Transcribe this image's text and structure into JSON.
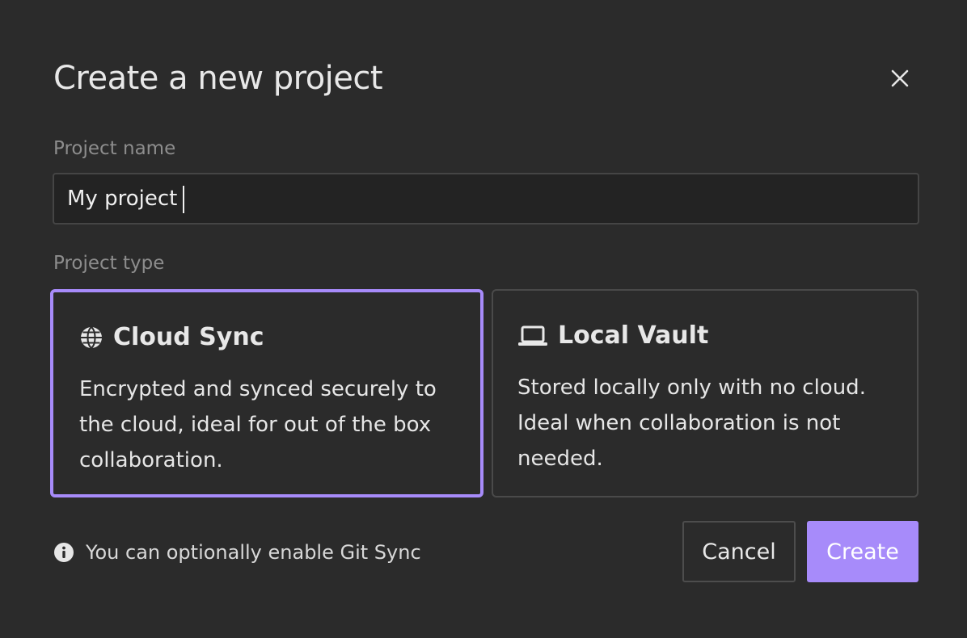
{
  "dialog": {
    "title": "Create a new project",
    "close_icon": "close-icon"
  },
  "name_field": {
    "label": "Project name",
    "value": "My project"
  },
  "type_field": {
    "label": "Project type",
    "selected": "cloud_sync",
    "options": [
      {
        "id": "cloud_sync",
        "title": "Cloud Sync",
        "icon": "globe-icon",
        "description": "Encrypted and synced securely to the cloud, ideal for out of the box collaboration."
      },
      {
        "id": "local_vault",
        "title": "Local Vault",
        "icon": "laptop-icon",
        "description": "Stored locally only with no cloud. Ideal when collaboration is not needed."
      }
    ]
  },
  "hint": {
    "icon": "info-icon",
    "text": "You can optionally enable Git Sync"
  },
  "actions": {
    "cancel_label": "Cancel",
    "create_label": "Create"
  },
  "colors": {
    "background": "#2b2b2b",
    "accent": "#a78bfa",
    "muted_text": "#8d8d8d",
    "border": "#4a4a4a"
  }
}
